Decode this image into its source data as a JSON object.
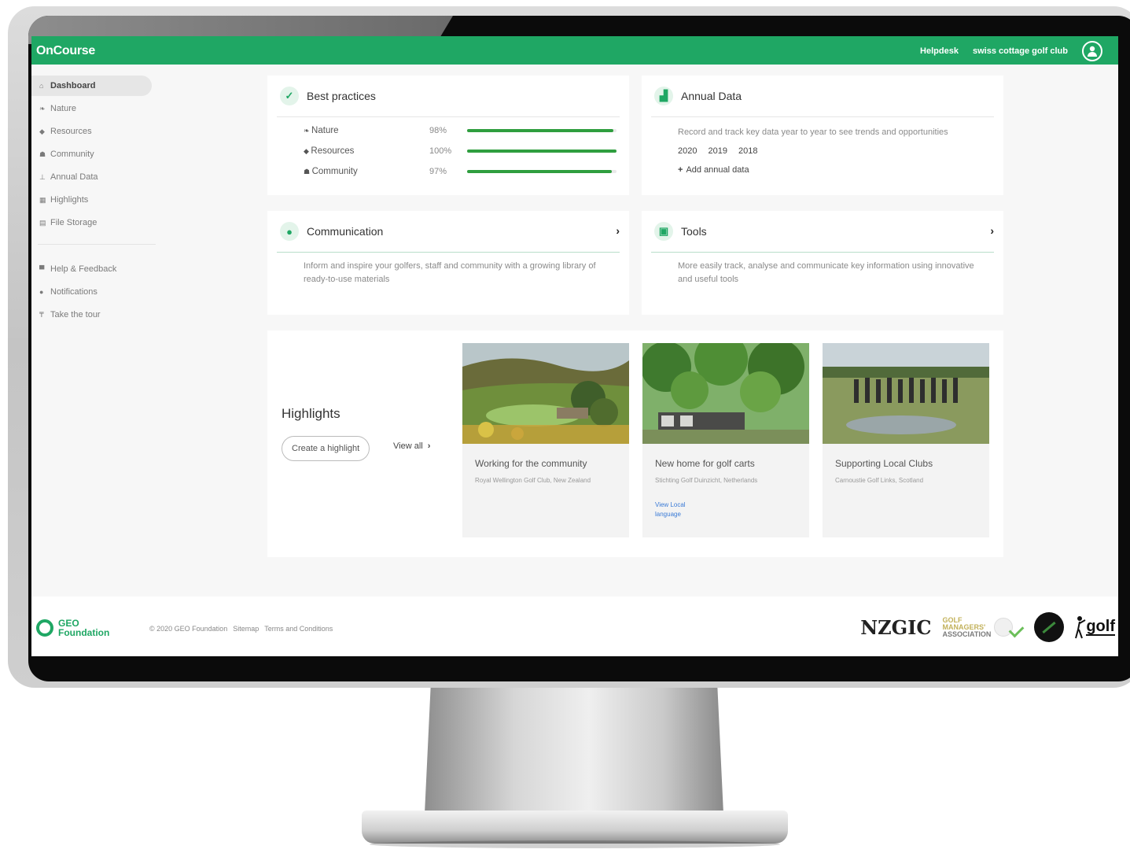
{
  "topbar": {
    "brand": "OnCourse",
    "helpdesk": "Helpdesk",
    "club_name": "swiss cottage golf club"
  },
  "sidebar": {
    "items": [
      {
        "label": "Dashboard",
        "icon": "dashboard-icon",
        "glyph": "⌂",
        "active": true
      },
      {
        "label": "Nature",
        "icon": "leaf-icon",
        "glyph": "❧",
        "active": false
      },
      {
        "label": "Resources",
        "icon": "water-drop-icon",
        "glyph": "◆",
        "active": false
      },
      {
        "label": "Community",
        "icon": "people-icon",
        "glyph": "☗",
        "active": false
      },
      {
        "label": "Annual Data",
        "icon": "chart-icon",
        "glyph": "⊥",
        "active": false
      },
      {
        "label": "Highlights",
        "icon": "image-icon",
        "glyph": "▦",
        "active": false
      },
      {
        "label": "File Storage",
        "icon": "file-icon",
        "glyph": "▤",
        "active": false
      }
    ],
    "secondary": [
      {
        "label": "Help & Feedback",
        "icon": "chat-icon",
        "glyph": "▀"
      },
      {
        "label": "Notifications",
        "icon": "bell-icon",
        "glyph": "●"
      },
      {
        "label": "Take the tour",
        "icon": "flag-icon",
        "glyph": "₸"
      }
    ]
  },
  "best_practices": {
    "title": "Best practices",
    "rows": [
      {
        "label": "Nature",
        "pct": "98%",
        "value": 0.98
      },
      {
        "label": "Resources",
        "pct": "100%",
        "value": 1.0
      },
      {
        "label": "Community",
        "pct": "97%",
        "value": 0.97
      }
    ]
  },
  "annual_data": {
    "title": "Annual Data",
    "description": "Record and track key data year to year to see trends and opportunities",
    "years": [
      "2020",
      "2019",
      "2018"
    ],
    "add_label": "Add annual data"
  },
  "communication": {
    "title": "Communication",
    "description": "Inform and inspire your golfers, staff and community with a growing library of ready-to-use materials"
  },
  "tools": {
    "title": "Tools",
    "description": "More easily track, analyse and communicate key information using innovative and useful tools"
  },
  "highlights": {
    "title": "Highlights",
    "create_label": "Create a highlight",
    "view_all_label": "View all",
    "items": [
      {
        "title": "Working for the community",
        "subtitle": "Royal Wellington Golf Club, New Zealand"
      },
      {
        "title": "New home for golf carts",
        "subtitle": "Stichting Golf Duinzicht, Netherlands",
        "link": "View Local language"
      },
      {
        "title": "Supporting Local Clubs",
        "subtitle": "Carnoustie Golf Links, Scotland"
      }
    ]
  },
  "footer": {
    "logo_line1": "GEO",
    "logo_line2": "Foundation",
    "copyright": "© 2020 GEO Foundation",
    "sitemap": "Sitemap",
    "terms": "Terms and Conditions",
    "partner1": "NZGIC",
    "partner2": [
      "GOLF",
      "MANAGERS'",
      "ASSOCIATION"
    ],
    "partner4": "golf"
  },
  "colors": {
    "brand_green": "#1fa764",
    "progress_green": "#2f9e3f",
    "link_blue": "#3b7bd6"
  }
}
